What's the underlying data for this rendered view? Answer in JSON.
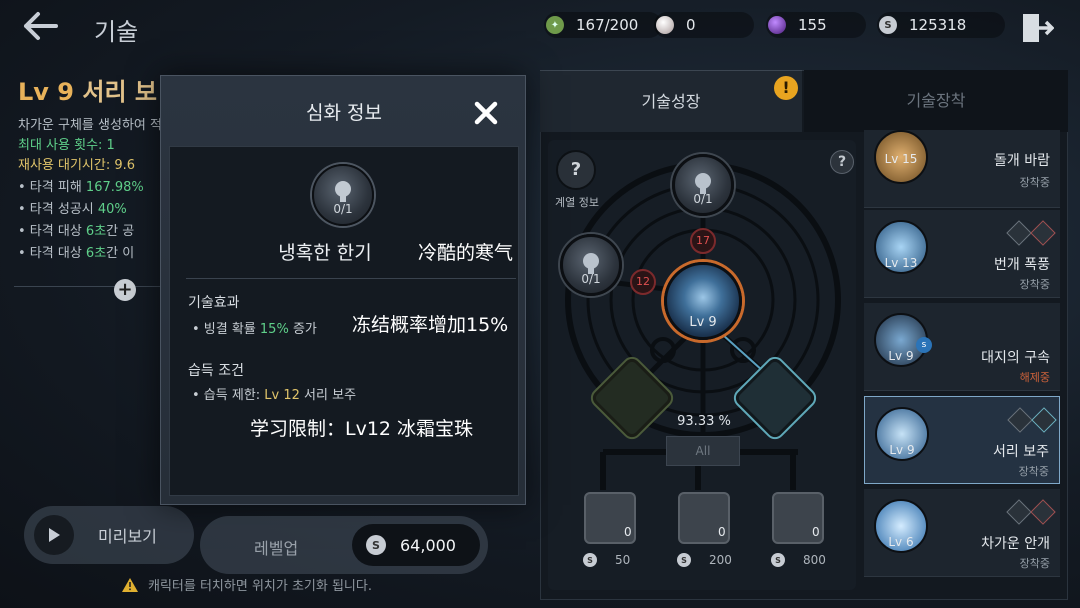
{
  "header": {
    "title": "기술",
    "resources": {
      "stamina": "167/200",
      "pearl": "0",
      "gem": "155",
      "silver": "125318"
    }
  },
  "skill_info": {
    "level": "Lv 9",
    "name": "서리 보",
    "desc": "차가운 구체를 생성하여 적에게 날린다",
    "max_uses_label": "최대 사용 횟수:",
    "max_uses_value": "1",
    "cooldown_label": "재사용 대기시간:",
    "cooldown_value": "9.6",
    "effect1_pre": "• 타격 피해",
    "effect1_val": "167.98%",
    "effect2_pre": "• 타격 성공시",
    "effect2_val": "40%",
    "effect3_pre": "• 타격 대상",
    "effect3_val": "6초",
    "effect3_post": "간 공",
    "effect4_pre": "• 타격 대상",
    "effect4_val": "6초",
    "effect4_post": "간 이"
  },
  "preview_label": "미리보기",
  "warning_text": "캐릭터를 터치하면 위치가 초기화 됩니다.",
  "modal": {
    "title": "심화 정보",
    "node_count": "0/1",
    "node_name": "냉혹한 한기",
    "node_name_cn": "冷酷的寒气",
    "effect_heading": "기술효과",
    "effect_pre": "• 빙결 확률 ",
    "effect_val": "15%",
    "effect_post": " 증가",
    "effect_cn": "冻结概率增加15%",
    "cond_heading": "습득 조건",
    "cond_pre": "• 습득 제한: ",
    "cond_val": "Lv 12",
    "cond_post": " 서리 보주",
    "cond_cn": "学习限制：Lv12 冰霜宝珠"
  },
  "levelup": {
    "label": "레벨업",
    "cost": "64,000"
  },
  "tabs": {
    "growth": "기술성장",
    "equip": "기술장착",
    "alert": "!"
  },
  "tree": {
    "lineage_label": "계열 정보",
    "lineage_icon": "?",
    "help_icon": "?",
    "node_top_count": "0/1",
    "node_left_count": "0/1",
    "badge_top": "17",
    "badge_left": "12",
    "center_level": "Lv 9",
    "progress": "93.33 %",
    "all_label": "All",
    "books": [
      {
        "count": "0",
        "cost": "50"
      },
      {
        "count": "0",
        "cost": "200"
      },
      {
        "count": "0",
        "cost": "800"
      }
    ]
  },
  "skill_list": [
    {
      "level": "Lv 15",
      "name": "돌개 바람",
      "status": "장착중",
      "color": "#b8894a"
    },
    {
      "level": "Lv 13",
      "name": "번개 폭풍",
      "status": "장착중",
      "color": "#4a7fb8"
    },
    {
      "level": "Lv 9",
      "name": "대지의 구속",
      "status": "해제중",
      "color": "#3a5a7a"
    },
    {
      "level": "Lv 9",
      "name": "서리 보주",
      "status": "장착중",
      "color": "#5a8cc0"
    },
    {
      "level": "Lv 6",
      "name": "차가운 안개",
      "status": "장착중",
      "color": "#4a90c8"
    }
  ],
  "colors": {
    "accent_orange": "#c96a2c",
    "effect_green": "#5fd08a",
    "level_gold": "#e8b25a",
    "alert": "#e8a420"
  }
}
